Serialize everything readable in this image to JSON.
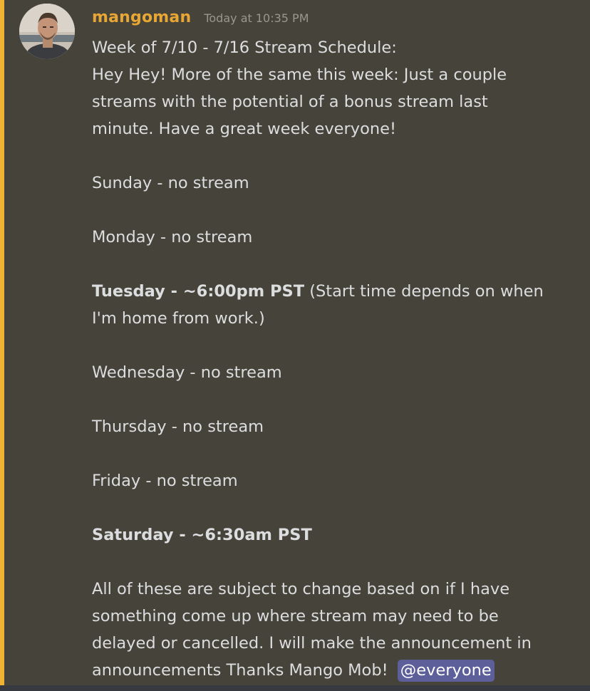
{
  "message": {
    "author": "mangoman",
    "timestamp": "Today at 10:35 PM",
    "lines": {
      "title": "Week of 7/10 - 7/16 Stream Schedule:",
      "intro1": "Hey Hey! More of the same this week: Just a couple",
      "intro2": "streams with the potential of a bonus stream last",
      "intro3": "minute. Have a great week everyone!",
      "sunday": "Sunday - no stream",
      "monday": "Monday - no stream",
      "tuesday_bold": "Tuesday - ~6:00pm PST",
      "tuesday_note": " (Start time depends on when",
      "tuesday_note2": "I'm home from work.)",
      "wednesday": "Wednesday - no stream",
      "thursday": "Thursday - no stream",
      "friday": "Friday - no stream",
      "saturday_bold": "Saturday - ~6:30am PST",
      "outro1": "All of these are subject to change based on if I have",
      "outro2": "something come up where stream may need to be",
      "outro3": "delayed or cancelled. I will make the announcement in",
      "outro4": "announcements Thanks Mango Mob! "
    },
    "mention": "@everyone"
  },
  "colors": {
    "background": "#46433b",
    "mention_bar": "#f0b232",
    "username": "#e8a734",
    "mention_bg": "#5c5f9a"
  }
}
